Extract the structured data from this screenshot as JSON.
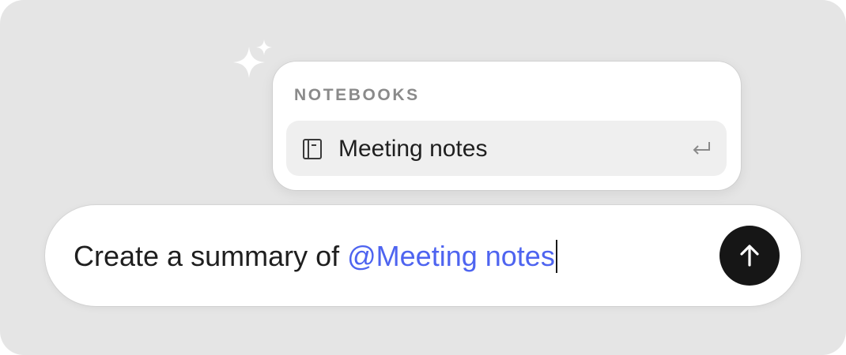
{
  "popover": {
    "heading": "NOTEBOOKS",
    "items": [
      {
        "label": "Meeting notes",
        "icon": "notebook-icon",
        "shortcut_icon": "enter-key-icon"
      }
    ]
  },
  "composer": {
    "text": "Create a summary of ",
    "mention": "@Meeting notes",
    "send_icon": "arrow-up-icon"
  },
  "colors": {
    "background": "#e5e5e5",
    "surface": "#ffffff",
    "highlight": "#efefef",
    "mention": "#4e64f0",
    "send_button": "#161616",
    "heading": "#8a8a8a"
  }
}
